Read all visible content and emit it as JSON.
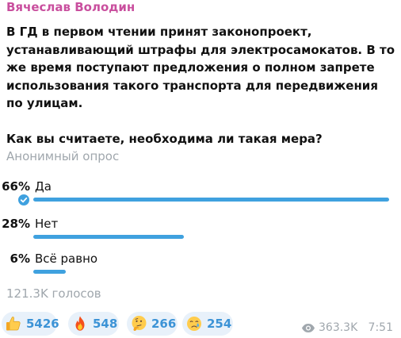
{
  "message": {
    "author": "Вячеслав Володин",
    "text_paragraph_1": "В ГД в первом чтении принят законопроект, устанавливающий штрафы для электросамокатов. В то же время поступают предложения о полном запрете использования такого транспорта для передвижения по улицам.",
    "text_paragraph_2": "Как вы считаете, необходима ли такая мера?",
    "poll_type": "Анонимный опрос",
    "options": [
      {
        "percent_label": "66%",
        "label": "Да",
        "percent": 66,
        "selected": true
      },
      {
        "percent_label": "28%",
        "label": "Нет",
        "percent": 28,
        "selected": false
      },
      {
        "percent_label": "6%",
        "label": "Всё равно",
        "percent": 6,
        "selected": false
      }
    ],
    "total_votes": "121.3K голосов",
    "reactions": [
      {
        "emoji": "thumbs-up-icon",
        "count": "5426"
      },
      {
        "emoji": "fire-icon",
        "count": "548"
      },
      {
        "emoji": "thinking-face-icon",
        "count": "266"
      },
      {
        "emoji": "crying-face-icon",
        "count": "254"
      }
    ],
    "views": "363.3K",
    "time": "7:51"
  },
  "colors": {
    "author": "#c94f9e",
    "accent": "#3fa1df",
    "muted": "#a0a7ad",
    "reaction_bg": "#e8f1fa",
    "reaction_text": "#3c93d6"
  }
}
